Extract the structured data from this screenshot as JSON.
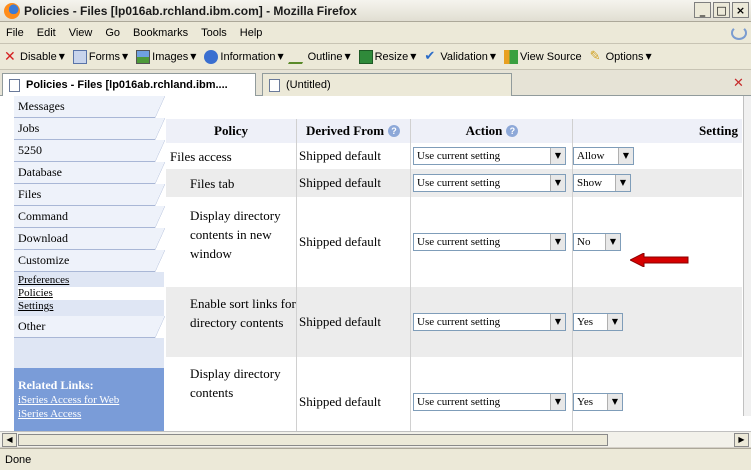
{
  "window": {
    "title": "Policies - Files [lp016ab.rchland.ibm.com] - Mozilla Firefox"
  },
  "menubar": [
    "File",
    "Edit",
    "View",
    "Go",
    "Bookmarks",
    "Tools",
    "Help"
  ],
  "toolbar": [
    {
      "label": "Disable",
      "icon": "disable-icon"
    },
    {
      "label": "Forms",
      "icon": "forms-icon"
    },
    {
      "label": "Images",
      "icon": "images-icon"
    },
    {
      "label": "Information",
      "icon": "information-icon"
    },
    {
      "label": "Outline",
      "icon": "outline-icon"
    },
    {
      "label": "Resize",
      "icon": "resize-icon"
    },
    {
      "label": "Validation",
      "icon": "validation-icon"
    },
    {
      "label": "View Source",
      "icon": "view-source-icon"
    },
    {
      "label": "Options",
      "icon": "options-icon"
    }
  ],
  "tabs": {
    "active": "Policies - Files [lp016ab.rchland.ibm....",
    "inactive": "(Untitled)"
  },
  "nav": {
    "items": [
      "Messages",
      "Jobs",
      "5250",
      "Database",
      "Files",
      "Command",
      "Download",
      "Customize"
    ],
    "sub_items": [
      "Preferences",
      "Policies",
      "Settings"
    ],
    "other": "Other",
    "related_header": "Related Links:",
    "related_links": [
      "iSeries Access for Web",
      "iSeries Access"
    ]
  },
  "table": {
    "headers": {
      "policy": "Policy",
      "derived": "Derived From",
      "action": "Action",
      "setting": "Setting"
    },
    "rows": [
      {
        "policy": "Files access",
        "derived": "Shipped default",
        "action": "Use current setting",
        "setting": "Allow"
      },
      {
        "policy": "Files tab",
        "derived": "Shipped default",
        "action": "Use current setting",
        "setting": "Show"
      },
      {
        "policy": "Display directory contents in new window",
        "derived": "Shipped default",
        "action": "Use current setting",
        "setting": "No"
      },
      {
        "policy": "Enable sort links for directory contents",
        "derived": "Shipped default",
        "action": "Use current setting",
        "setting": "Yes"
      },
      {
        "policy": "Display directory contents",
        "derived": "Shipped default",
        "action": "Use current setting",
        "setting": "Yes"
      }
    ]
  },
  "status": "Done",
  "colors": {
    "nav_bg": "#dfe6f4",
    "related_bg": "#7a9cd8",
    "arrow": "#d60000"
  }
}
